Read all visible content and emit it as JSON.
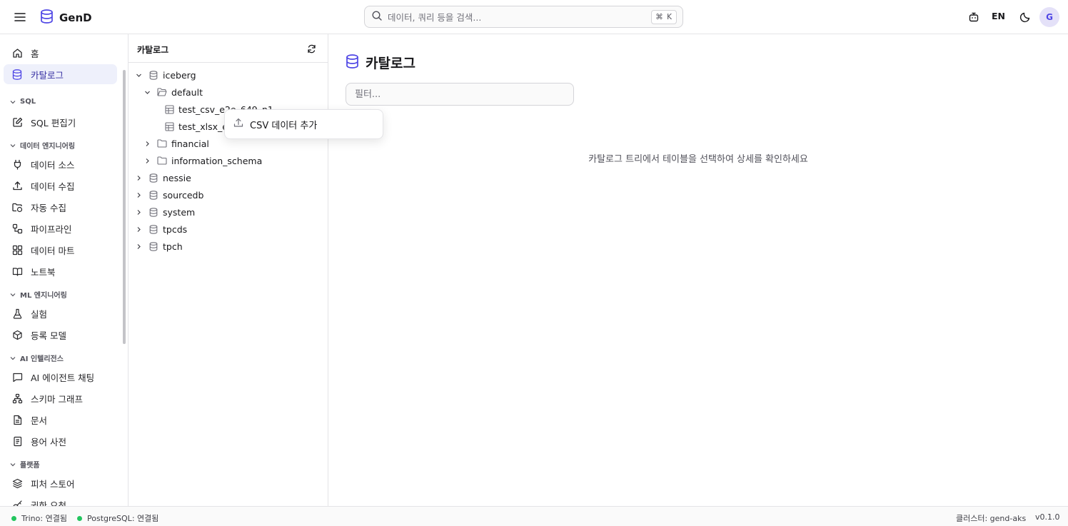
{
  "header": {
    "app_name": "GenD",
    "search_placeholder": "데이터, 쿼리 등을 검색...",
    "search_shortcut": "⌘ K",
    "language": "EN",
    "avatar_initial": "G"
  },
  "sidebar": {
    "items_top": [
      {
        "label": "홈",
        "icon": "home-icon"
      },
      {
        "label": "카탈로그",
        "icon": "database-icon",
        "active": true
      }
    ],
    "sections": [
      {
        "title": "SQL",
        "items": [
          {
            "label": "SQL 편집기",
            "icon": "edit-icon"
          }
        ]
      },
      {
        "title": "데이터 엔지니어링",
        "items": [
          {
            "label": "데이터 소스",
            "icon": "plug-icon"
          },
          {
            "label": "데이터 수집",
            "icon": "upload-icon"
          },
          {
            "label": "자동 수집",
            "icon": "folder-sync-icon"
          },
          {
            "label": "파이프라인",
            "icon": "workflow-icon"
          },
          {
            "label": "데이터 마트",
            "icon": "grid-icon"
          },
          {
            "label": "노트북",
            "icon": "book-icon"
          }
        ]
      },
      {
        "title": "ML 엔지니어링",
        "items": [
          {
            "label": "실험",
            "icon": "flask-icon"
          },
          {
            "label": "등록 모델",
            "icon": "box-icon"
          }
        ]
      },
      {
        "title": "AI 인텔리전스",
        "items": [
          {
            "label": "AI 에이전트 채팅",
            "icon": "chat-icon"
          },
          {
            "label": "스키마 그래프",
            "icon": "network-icon"
          },
          {
            "label": "문서",
            "icon": "document-icon"
          },
          {
            "label": "용어 사전",
            "icon": "dictionary-icon"
          }
        ]
      },
      {
        "title": "플랫폼",
        "items": [
          {
            "label": "피처 스토어",
            "icon": "layers-icon"
          },
          {
            "label": "권한 요청",
            "icon": "key-icon"
          }
        ]
      }
    ]
  },
  "catalog_panel": {
    "title": "카탈로그",
    "tree": [
      {
        "label": "iceberg",
        "type": "catalog",
        "expanded": true
      },
      {
        "label": "default",
        "type": "schema",
        "expanded": true
      },
      {
        "label": "test_csv_e2e_649_n1",
        "type": "table"
      },
      {
        "label": "test_xlsx_e",
        "type": "table"
      },
      {
        "label": "financial",
        "type": "schema",
        "expanded": false
      },
      {
        "label": "information_schema",
        "type": "schema",
        "expanded": false
      },
      {
        "label": "nessie",
        "type": "catalog",
        "expanded": false
      },
      {
        "label": "sourcedb",
        "type": "catalog",
        "expanded": false
      },
      {
        "label": "system",
        "type": "catalog",
        "expanded": false
      },
      {
        "label": "tpcds",
        "type": "catalog",
        "expanded": false
      },
      {
        "label": "tpch",
        "type": "catalog",
        "expanded": false
      }
    ]
  },
  "context_menu": {
    "items": [
      {
        "label": "CSV 데이터 추가",
        "icon": "upload-icon"
      }
    ]
  },
  "main": {
    "title": "카탈로그",
    "filter_placeholder": "필터...",
    "empty_message": "카탈로그 트리에서 테이블을 선택하여 상세를 확인하세요"
  },
  "footer": {
    "statuses": [
      {
        "label": "Trino: 연결됨",
        "color": "#22c55e"
      },
      {
        "label": "PostgreSQL: 연결됨",
        "color": "#22c55e"
      }
    ],
    "cluster": "클러스터: gend-aks",
    "version": "v0.1.0"
  },
  "colors": {
    "accent": "#4f46e5",
    "active_bg": "#eef0fb"
  }
}
